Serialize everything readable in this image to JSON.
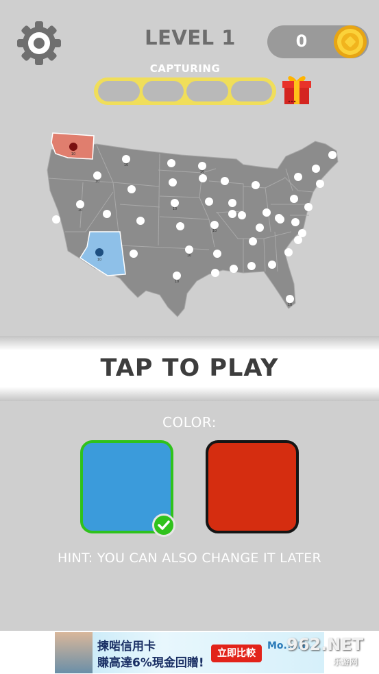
{
  "header": {
    "level_title": "LEVEL 1",
    "coins": "0",
    "capturing_label": "CAPTURING",
    "progress_segments": 4,
    "progress_filled": 0
  },
  "map": {
    "selected_states": [
      {
        "state": "Washington",
        "color": "#e07e6e",
        "marker_color": "#7a1010"
      },
      {
        "state": "Arizona",
        "color": "#8ec0e8",
        "marker_color": "#1e4f80"
      }
    ],
    "neutral_color": "#8c8c8c",
    "marker_label": "10"
  },
  "play": {
    "label": "TAP TO PLAY"
  },
  "color_picker": {
    "label": "COLOR:",
    "options": [
      {
        "name": "blue",
        "hex": "#3b9bdb",
        "selected": true
      },
      {
        "name": "red",
        "hex": "#d52d10",
        "selected": false
      }
    ],
    "hint": "HINT: YOU CAN ALSO CHANGE IT LATER"
  },
  "ad": {
    "line1": "揀啱信用卡",
    "line2": "賺高達6%現金回贈!",
    "button": "立即比較",
    "brand": "Mo... H..."
  },
  "watermark": {
    "main": "962.NET",
    "sub": "乐游网"
  }
}
